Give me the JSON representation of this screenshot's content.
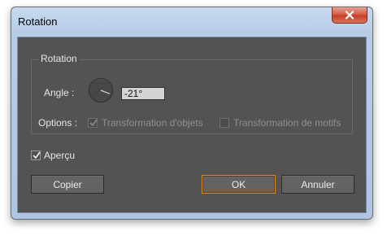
{
  "window": {
    "title": "Rotation"
  },
  "rotation_group": {
    "legend": "Rotation",
    "angle_label": "Angle :",
    "angle_value": "-21°",
    "angle_degrees": -21
  },
  "options": {
    "label": "Options :",
    "transform_objects": {
      "label": "Transformation d'objets",
      "checked": true,
      "enabled": false
    },
    "transform_patterns": {
      "label": "Transformation de motifs",
      "checked": false,
      "enabled": false
    }
  },
  "preview": {
    "label": "Aperçu",
    "checked": true
  },
  "buttons": {
    "copy": "Copier",
    "ok": "OK",
    "cancel": "Annuler"
  },
  "colors": {
    "panel": "#535353",
    "default_button_border": "#e08a1e"
  }
}
